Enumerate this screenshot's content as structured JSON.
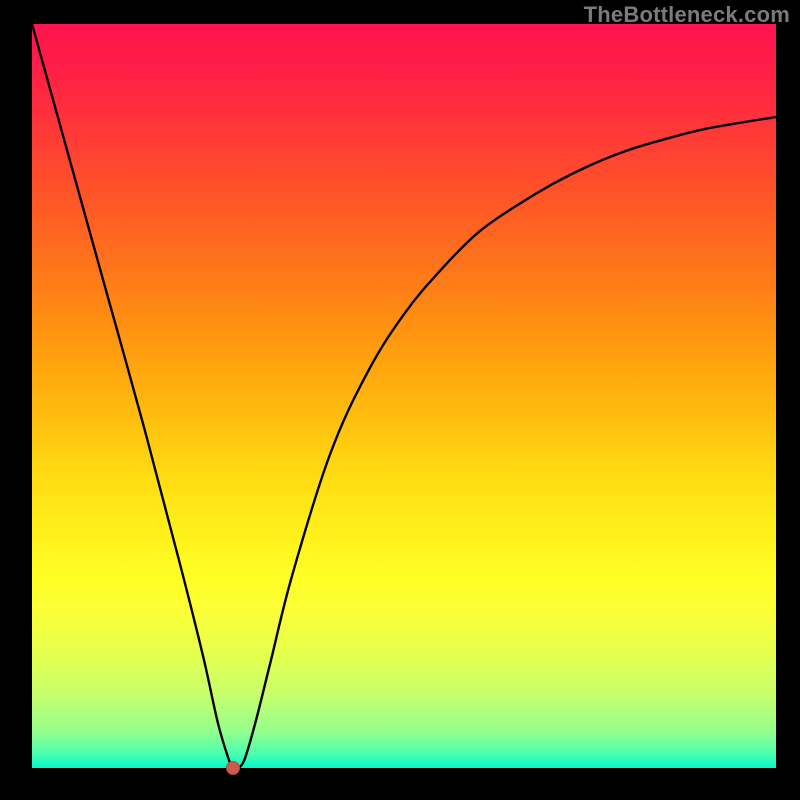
{
  "attribution": "TheBottleneck.com",
  "chart_data": {
    "type": "line",
    "title": "",
    "xlabel": "",
    "ylabel": "",
    "xlim": [
      0,
      100
    ],
    "ylim": [
      0,
      100
    ],
    "series": [
      {
        "name": "bottleneck-curve",
        "x": [
          0,
          5,
          10,
          15,
          20,
          23,
          25,
          26.5,
          27,
          27.5,
          28.5,
          30,
          32,
          35,
          40,
          45,
          50,
          55,
          60,
          65,
          70,
          75,
          80,
          85,
          90,
          95,
          100
        ],
        "values": [
          100,
          82,
          64,
          46,
          27,
          15,
          6,
          1,
          0,
          0,
          1,
          6,
          14,
          26,
          42,
          53,
          61,
          67,
          72,
          75.5,
          78.5,
          81,
          83,
          84.5,
          85.8,
          86.7,
          87.5
        ]
      }
    ],
    "marker": {
      "x": 27,
      "y": 0,
      "name": "optimal-point"
    },
    "background_gradient": {
      "top": "#ff1450",
      "mid": "#ffde10",
      "bottom": "#06f7c6"
    }
  }
}
